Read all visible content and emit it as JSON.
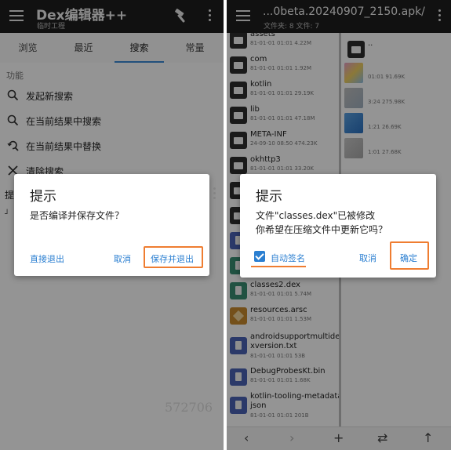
{
  "left": {
    "app_title": "Dex编辑器++",
    "app_subtitle": "临时工程",
    "tabs": [
      "浏览",
      "最近",
      "搜索",
      "常量"
    ],
    "section_label": "功能",
    "menu_items": [
      "发起新搜索",
      "在当前结果中搜索",
      "在当前结果中替换",
      "清除搜索"
    ],
    "partial_label": "提",
    "watermark": "572706",
    "dialog": {
      "title": "提示",
      "message": "是否编译并保存文件？",
      "buttons": {
        "exit": "直接退出",
        "cancel": "取消",
        "save_exit": "保存并退出"
      }
    }
  },
  "right": {
    "path_title": "...0beta.20240907_2150.apk/",
    "path_subtitle": "文件夹: 8  文件: 7",
    "files": [
      {
        "name": "assets",
        "meta": "81-01-01 01:01  4.22M",
        "type": "folder"
      },
      {
        "name": "com",
        "meta": "81-01-01 01:01  1.92M",
        "type": "folder"
      },
      {
        "name": "kotlin",
        "meta": "81-01-01 01:01  29.19K",
        "type": "folder"
      },
      {
        "name": "lib",
        "meta": "81-01-01 01:01  47.18M",
        "type": "folder"
      },
      {
        "name": "META-INF",
        "meta": "24-09-10 08:50  474.23K",
        "type": "folder"
      },
      {
        "name": "okhttp3",
        "meta": "81-01-01 01:01  33.20K",
        "type": "folder"
      },
      {
        "name": "classes2.dex",
        "meta": "81-01-01 01:01  5.74M",
        "type": "bin"
      },
      {
        "name": "resources.arsc",
        "meta": "81-01-01 01:01  1.53M",
        "type": "arsc"
      },
      {
        "name": "androidsupportmultide",
        "name2": "xversion.txt",
        "meta": "81-01-01 01:01  53B",
        "type": "dex"
      },
      {
        "name": "DebugProbesKt.bin",
        "meta": "81-01-01 01:01  1.68K",
        "type": "dex"
      },
      {
        "name": "kotlin-tooling-metadata",
        "name2": "json",
        "meta": "81-01-01 01:01  201B",
        "type": "dex"
      }
    ],
    "side_items": [
      {
        "name": "..",
        "meta": ""
      },
      {
        "name": "",
        "meta": "01:01  91.69K"
      },
      {
        "name": "",
        "meta": "3:24  275.98K"
      },
      {
        "name": "",
        "meta": "1:21  26.69K"
      },
      {
        "name": "",
        "meta": "1:01  27.68K"
      }
    ],
    "dialog": {
      "title": "提示",
      "message_line1": "文件\"classes.dex\"已被修改",
      "message_line2": "你希望在压缩文件中更新它吗？",
      "checkbox_label": "自动签名",
      "checkbox_checked": true,
      "buttons": {
        "cancel": "取消",
        "ok": "确定"
      }
    }
  },
  "colors": {
    "accent": "#2b7fd1",
    "highlight": "#ef7d31",
    "appbar": "#1e1e1e"
  }
}
